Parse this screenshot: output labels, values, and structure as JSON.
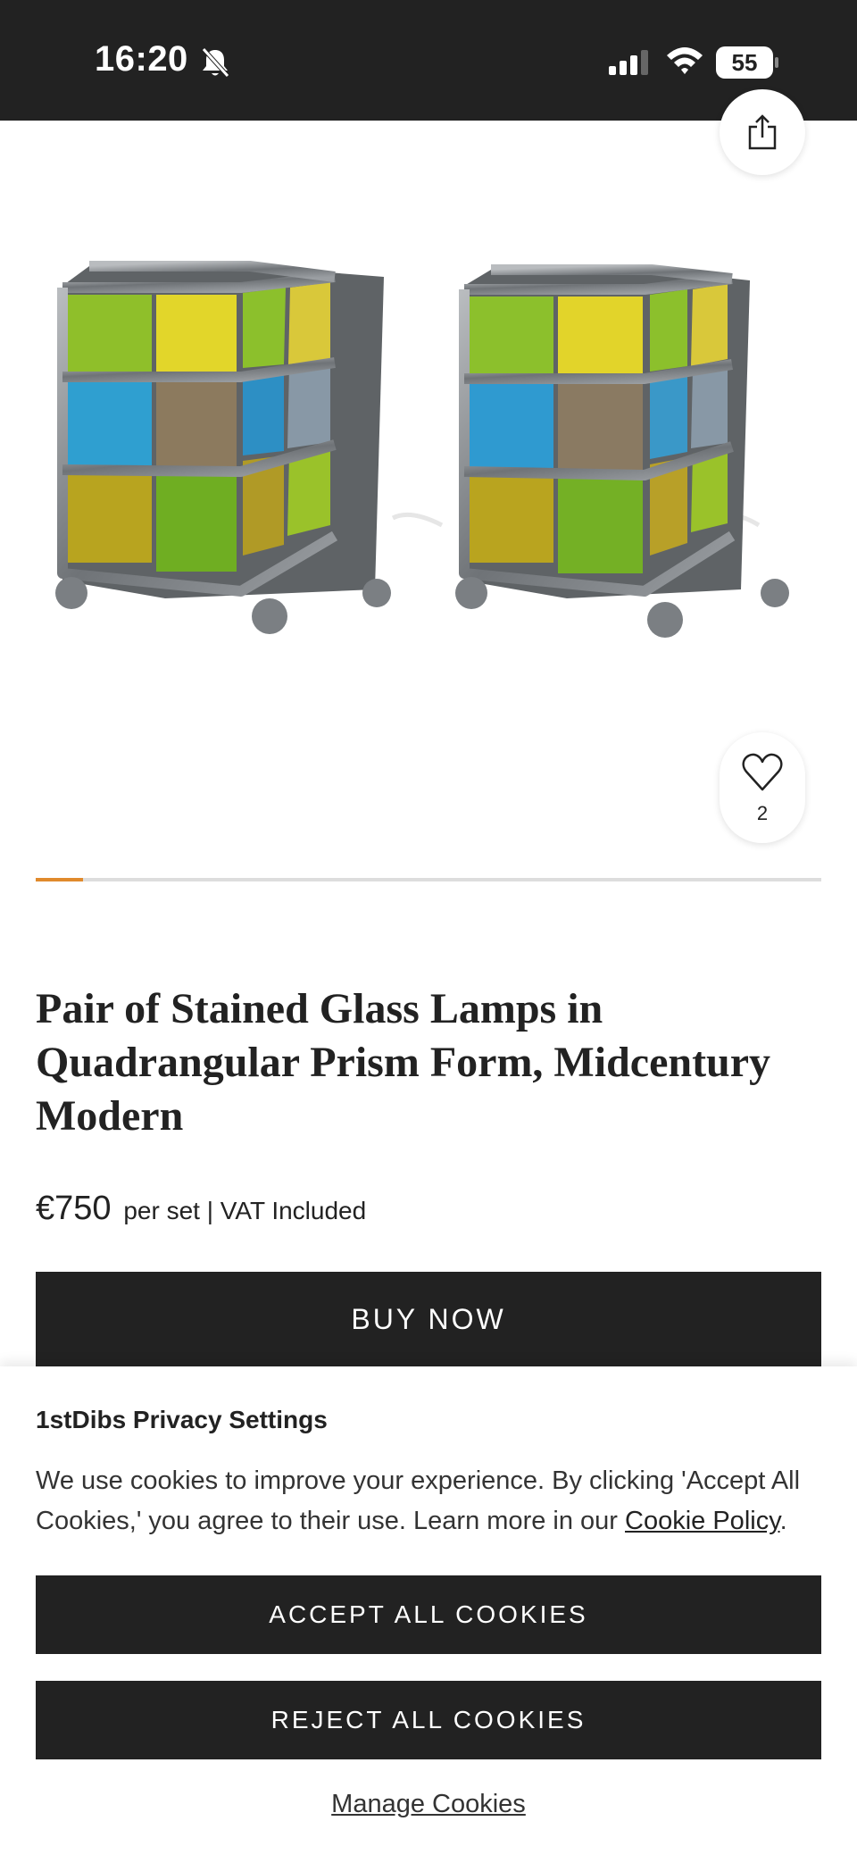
{
  "status_bar": {
    "time": "16:20",
    "battery": "55"
  },
  "product": {
    "title": "Pair of Stained Glass Lamps in Quadrangular Prism Form, Midcentury Modern",
    "price": "€750",
    "price_note": "per set | VAT Included",
    "favorites_count": "2",
    "buy_label": "BUY NOW",
    "carousel_progress": 0.06
  },
  "cookie_banner": {
    "title": "1stDibs Privacy Settings",
    "body": "We use cookies to improve your experience. By clicking 'Accept All Cookies,' you agree to their use. Learn more in our ",
    "link_text": "Cookie Policy",
    "body_end": ".",
    "accept_label": "ACCEPT ALL COOKIES",
    "reject_label": "REJECT ALL COOKIES",
    "manage_label": "Manage Cookies"
  },
  "colors": {
    "dark": "#222222",
    "accent": "#e08a2c"
  }
}
